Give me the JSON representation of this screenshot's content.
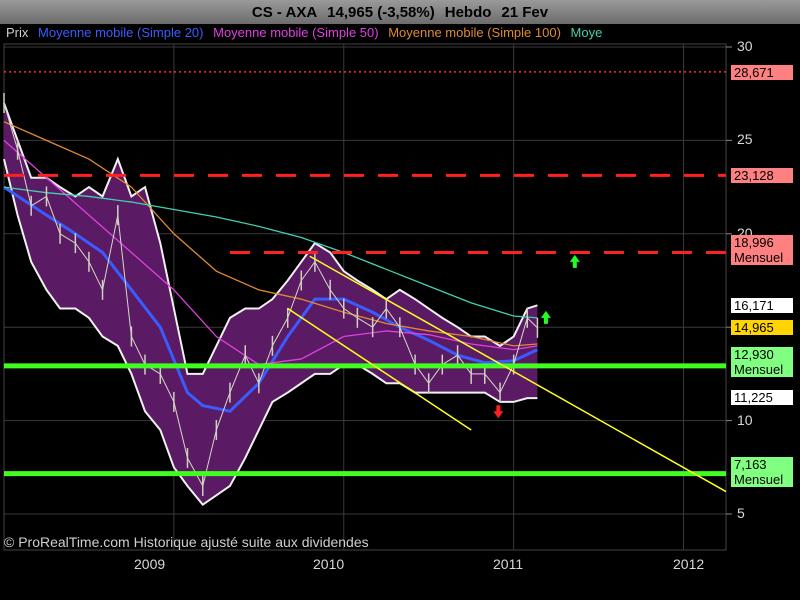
{
  "header": {
    "symbol": "CS - AXA",
    "last": "14,965 (-3,58%)",
    "period": "Hebdo",
    "date": "21 Fev"
  },
  "legend": [
    {
      "label": "Prix",
      "color": "#cfcfcf"
    },
    {
      "label": "Moyenne mobile (Simple 20)",
      "color": "#3a5cff"
    },
    {
      "label": "Moyenne mobile (Simple 50)",
      "color": "#e040e0"
    },
    {
      "label": "Moyenne mobile (Simple 100)",
      "color": "#e08a30"
    },
    {
      "label": "Moye",
      "color": "#40d0b0"
    }
  ],
  "credits": "© ProRealTime.com Historique ajusté suite aux dividendes",
  "price_labels": [
    {
      "value": "28,671",
      "bg": "#ff8080",
      "sub": ""
    },
    {
      "value": "23,128",
      "bg": "#ff8080",
      "sub": ""
    },
    {
      "value": "18,996",
      "bg": "#ff8080",
      "sub": "Mensuel"
    },
    {
      "value": "16,171",
      "bg": "#ffffff",
      "sub": ""
    },
    {
      "value": "14,965",
      "bg": "#ffd400",
      "sub": ""
    },
    {
      "value": "12,930",
      "bg": "#80ff80",
      "sub": "Mensuel"
    },
    {
      "value": "11,225",
      "bg": "#ffffff",
      "sub": ""
    },
    {
      "value": "7,163",
      "bg": "#80ff80",
      "sub": "Mensuel"
    }
  ],
  "chart_data": {
    "type": "line",
    "x_ticks": [
      "2009",
      "2010",
      "2011",
      "2012"
    ],
    "y_ticks": [
      "30",
      "25",
      "20",
      "15",
      "10",
      "5"
    ],
    "ylim": [
      5,
      30
    ],
    "xlim": [
      2008.0,
      2012.25
    ],
    "grid": true,
    "price": {
      "x": [
        2008.0,
        2008.08,
        2008.16,
        2008.25,
        2008.33,
        2008.42,
        2008.5,
        2008.58,
        2008.67,
        2008.75,
        2008.83,
        2008.92,
        2009.0,
        2009.08,
        2009.17,
        2009.25,
        2009.33,
        2009.42,
        2009.5,
        2009.58,
        2009.67,
        2009.75,
        2009.83,
        2009.92,
        2010.0,
        2010.08,
        2010.17,
        2010.25,
        2010.33,
        2010.42,
        2010.5,
        2010.58,
        2010.67,
        2010.75,
        2010.83,
        2010.92,
        2011.0,
        2011.08,
        2011.14
      ],
      "y": [
        27.0,
        24.5,
        21.5,
        22.0,
        20.0,
        19.5,
        18.5,
        17.0,
        21.0,
        14.5,
        13.0,
        12.5,
        11.0,
        8.0,
        6.5,
        9.5,
        11.5,
        13.5,
        12.0,
        14.0,
        15.5,
        17.5,
        18.5,
        17.0,
        16.0,
        15.5,
        15.0,
        16.0,
        15.0,
        13.0,
        12.0,
        13.0,
        13.5,
        12.5,
        12.5,
        11.5,
        13.0,
        15.5,
        14.965
      ]
    },
    "bands": {
      "x": [
        2008.0,
        2008.08,
        2008.16,
        2008.25,
        2008.33,
        2008.42,
        2008.5,
        2008.58,
        2008.67,
        2008.75,
        2008.83,
        2008.92,
        2009.0,
        2009.08,
        2009.17,
        2009.25,
        2009.33,
        2009.42,
        2009.5,
        2009.58,
        2009.67,
        2009.75,
        2009.83,
        2009.92,
        2010.0,
        2010.08,
        2010.17,
        2010.25,
        2010.33,
        2010.42,
        2010.5,
        2010.58,
        2010.67,
        2010.75,
        2010.83,
        2010.92,
        2011.0,
        2011.08,
        2011.14
      ],
      "upper": [
        27.0,
        25.0,
        23.0,
        23.0,
        22.5,
        22.0,
        22.5,
        22.0,
        24.0,
        22.0,
        22.5,
        19.5,
        16.0,
        12.5,
        12.5,
        14.0,
        15.5,
        16.0,
        16.0,
        16.5,
        17.5,
        18.5,
        19.5,
        19.0,
        18.0,
        17.5,
        17.0,
        16.5,
        17.0,
        16.5,
        16.0,
        15.5,
        15.0,
        14.5,
        14.5,
        14.0,
        14.5,
        16.0,
        16.17
      ],
      "lower": [
        24.0,
        21.0,
        18.5,
        17.0,
        16.0,
        16.0,
        15.5,
        14.5,
        14.0,
        12.5,
        10.5,
        9.5,
        7.5,
        6.5,
        5.5,
        6.0,
        6.5,
        8.0,
        9.5,
        11.0,
        11.5,
        12.0,
        12.5,
        12.5,
        13.0,
        13.0,
        12.5,
        12.0,
        12.0,
        11.5,
        11.5,
        11.5,
        11.5,
        11.5,
        11.5,
        11.0,
        11.0,
        11.2,
        11.2
      ]
    },
    "series": [
      {
        "name": "Moyenne mobile (Simple 20)",
        "color": "#3a5cff",
        "x": [
          2008.0,
          2008.25,
          2008.42,
          2008.58,
          2008.75,
          2008.92,
          2009.08,
          2009.17,
          2009.33,
          2009.5,
          2009.67,
          2009.83,
          2010.0,
          2010.17,
          2010.33,
          2010.5,
          2010.67,
          2010.83,
          2011.0,
          2011.14
        ],
        "y": [
          22.5,
          21.0,
          20.0,
          19.0,
          17.0,
          15.0,
          11.5,
          10.8,
          10.5,
          12.0,
          14.5,
          16.5,
          16.5,
          15.8,
          15.0,
          14.3,
          13.5,
          13.1,
          13.2,
          13.8
        ]
      },
      {
        "name": "Moyenne mobile (Simple 50)",
        "color": "#e040e0",
        "x": [
          2008.0,
          2008.25,
          2008.5,
          2008.75,
          2009.0,
          2009.25,
          2009.5,
          2009.75,
          2010.0,
          2010.25,
          2010.5,
          2010.75,
          2011.0,
          2011.14
        ],
        "y": [
          25.0,
          23.0,
          21.0,
          19.0,
          17.0,
          14.5,
          13.0,
          13.3,
          14.5,
          14.8,
          14.6,
          14.1,
          13.8,
          14.0
        ]
      },
      {
        "name": "Moyenne mobile (Simple 100)",
        "color": "#e08a30",
        "x": [
          2008.0,
          2008.25,
          2008.5,
          2008.75,
          2009.0,
          2009.25,
          2009.5,
          2009.75,
          2010.0,
          2010.25,
          2010.5,
          2010.75,
          2011.0,
          2011.14
        ],
        "y": [
          26.0,
          25.0,
          24.0,
          22.5,
          20.0,
          18.0,
          17.0,
          16.5,
          15.8,
          15.2,
          14.8,
          14.5,
          14.0,
          14.1
        ]
      },
      {
        "name": "Moye",
        "color": "#40d0b0",
        "x": [
          2008.0,
          2008.25,
          2008.5,
          2008.75,
          2009.0,
          2009.25,
          2009.5,
          2009.75,
          2010.0,
          2010.25,
          2010.5,
          2010.75,
          2011.0,
          2011.14
        ],
        "y": [
          22.5,
          22.2,
          22.0,
          21.7,
          21.3,
          20.9,
          20.4,
          19.8,
          19.0,
          18.1,
          17.2,
          16.3,
          15.6,
          15.5
        ]
      }
    ],
    "hlines": [
      {
        "y": 28.671,
        "color": "#ff3030",
        "style": "dotted",
        "x_from": 2008.0
      },
      {
        "y": 23.128,
        "color": "#ff2020",
        "style": "dashed",
        "x_from": 2008.0
      },
      {
        "y": 18.996,
        "color": "#ff2020",
        "style": "dashed",
        "x_from": 2009.33
      },
      {
        "y": 12.93,
        "color": "#40ff20",
        "style": "solid",
        "x_from": 2008.0
      },
      {
        "y": 7.163,
        "color": "#40ff20",
        "style": "solid",
        "x_from": 2008.0
      }
    ],
    "trendlines": [
      {
        "x1": 2009.8,
        "y1": 18.8,
        "x2": 2012.25,
        "y2": 6.2,
        "color": "#ffff20"
      },
      {
        "x1": 2009.67,
        "y1": 16.0,
        "x2": 2010.75,
        "y2": 9.5,
        "color": "#ffff20"
      }
    ],
    "arrows": [
      {
        "x": 2011.36,
        "y": 18.5,
        "dir": "up",
        "color": "#20ff20"
      },
      {
        "x": 2011.19,
        "y": 15.5,
        "dir": "up",
        "color": "#20ff20"
      },
      {
        "x": 2010.91,
        "y": 10.5,
        "dir": "down",
        "color": "#ff2020"
      }
    ]
  }
}
